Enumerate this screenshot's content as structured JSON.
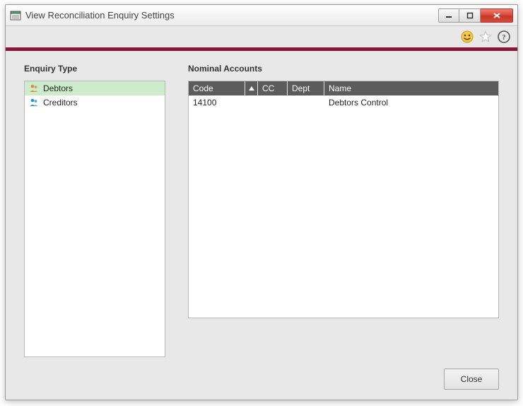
{
  "window": {
    "title": "View Reconciliation Enquiry Settings"
  },
  "toolbar": {
    "icons": {
      "smiley": "smiley-icon",
      "star": "star-icon",
      "help": "help-icon"
    }
  },
  "left": {
    "heading": "Enquiry Type",
    "items": [
      {
        "label": "Debtors",
        "selected": true,
        "iconColor": "#e08a3c"
      },
      {
        "label": "Creditors",
        "selected": false,
        "iconColor": "#2f8ecf"
      }
    ]
  },
  "right": {
    "heading": "Nominal Accounts",
    "columns": [
      {
        "key": "code",
        "label": "Code"
      },
      {
        "key": "cc",
        "label": "CC"
      },
      {
        "key": "dept",
        "label": "Dept"
      },
      {
        "key": "name",
        "label": "Name"
      }
    ],
    "rows": [
      {
        "code": "14100",
        "cc": "",
        "dept": "",
        "name": "Debtors Control"
      }
    ]
  },
  "footer": {
    "close_label": "Close"
  }
}
